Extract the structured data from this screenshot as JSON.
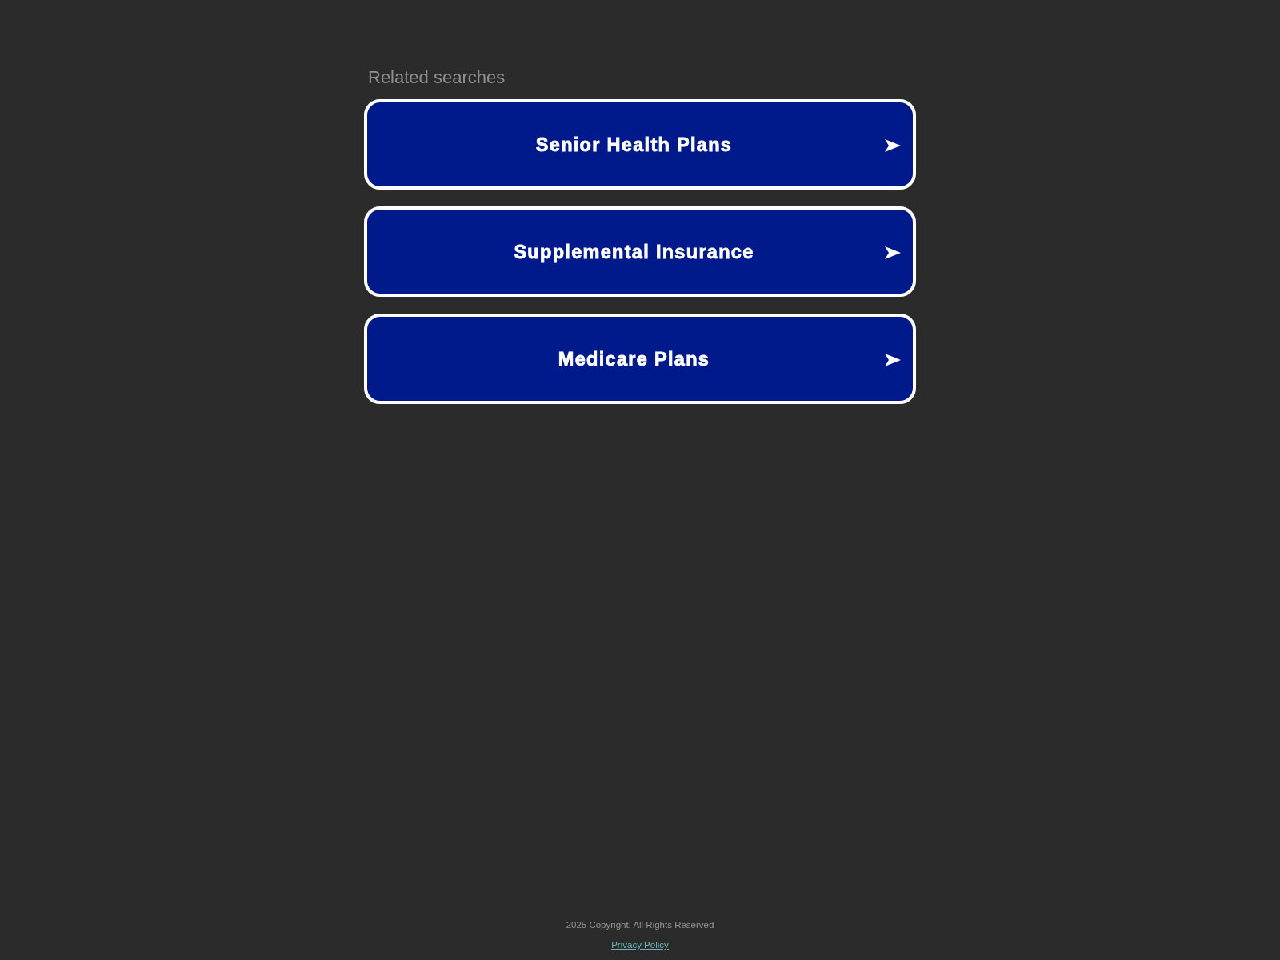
{
  "heading": "Related searches",
  "links": [
    {
      "label": "Senior Health Plans"
    },
    {
      "label": "Supplemental Insurance"
    },
    {
      "label": "Medicare Plans"
    }
  ],
  "footer": {
    "copyright": "2025 Copyright. All Rights Reserved",
    "privacy_link": "Privacy Policy"
  }
}
